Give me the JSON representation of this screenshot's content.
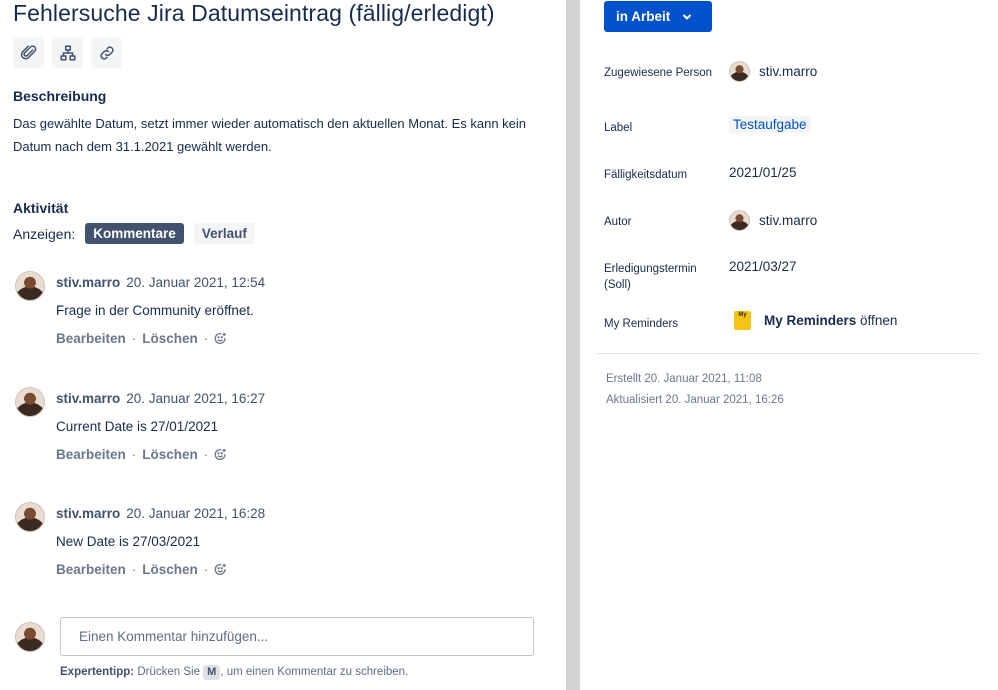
{
  "issue": {
    "title": "Fehlersuche Jira Datumseintrag (fällig/erledigt)",
    "icons": [
      "attachment-icon",
      "child-issue-icon",
      "link-icon"
    ]
  },
  "description": {
    "heading": "Beschreibung",
    "text": "Das gewählte Datum, setzt immer wieder automatisch den aktuellen Monat. Es kann kein Datum nach dem 31.1.2021 gewählt werden."
  },
  "activity": {
    "heading": "Aktivität",
    "show_label": "Anzeigen:",
    "filters": [
      {
        "label": "Kommentare",
        "active": true
      },
      {
        "label": "Verlauf",
        "active": false
      }
    ]
  },
  "comments": [
    {
      "author": "stiv.marro",
      "date": "20. Januar 2021, 12:54",
      "body": "Frage in der Community eröffnet.",
      "edit": "Bearbeiten",
      "delete": "Löschen"
    },
    {
      "author": "stiv.marro",
      "date": "20. Januar 2021, 16:27",
      "body": "Current Date is 27/01/2021",
      "edit": "Bearbeiten",
      "delete": "Löschen"
    },
    {
      "author": "stiv.marro",
      "date": "20. Januar 2021, 16:28",
      "body": "New Date is 27/03/2021",
      "edit": "Bearbeiten",
      "delete": "Löschen"
    }
  ],
  "add_comment": {
    "placeholder": "Einen Kommentar hinzufügen...",
    "tip_bold": "Expertentipp:",
    "tip_pre": "Drücken Sie",
    "tip_key": "M",
    "tip_post": ", um einen Kommentar zu schreiben."
  },
  "status": {
    "label": "in Arbeit"
  },
  "details": {
    "assignee_label": "Zugewiesene Person",
    "assignee": "stiv.marro",
    "label_label": "Label",
    "label_value": "Testaufgabe",
    "due_label": "Fälligkeitsdatum",
    "due_value": "2021/01/25",
    "reporter_label": "Autor",
    "reporter": "stiv.marro",
    "done_label": "Erledigungstermin (Soll)",
    "done_value": "2021/03/27",
    "reminders_label": "My Reminders",
    "reminders_icon_text": "My",
    "reminders_bold": "My Reminders",
    "reminders_open": "öffnen"
  },
  "meta": {
    "created": "Erstellt 20. Januar 2021, 11:08",
    "updated": "Aktualisiert 20. Januar 2021, 16:26"
  },
  "colors": {
    "primary": "#0052cc",
    "text": "#172b4d",
    "subtle": "#6b778c",
    "active_pill": "#42526e"
  }
}
